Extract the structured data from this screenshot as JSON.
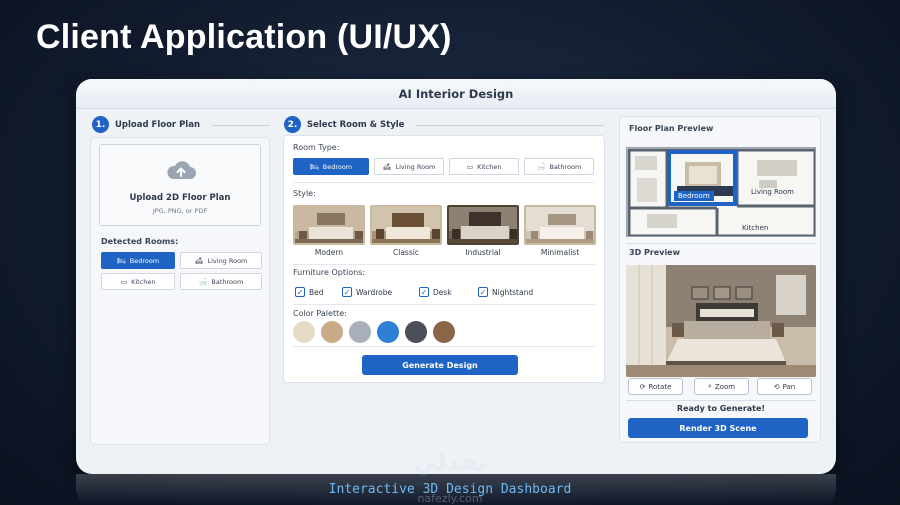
{
  "slide": {
    "title": "Client Application (UI/UX)",
    "caption": "Interactive 3D Design Dashboard",
    "watermark_text": "nafezly.com"
  },
  "window": {
    "title": "AI Interior Design"
  },
  "upload": {
    "step": "1.",
    "heading": "Upload Floor Plan",
    "box_title": "Upload 2D Floor Plan",
    "box_sub": "JPG, PNG, or PDF",
    "detected_label": "Detected Rooms:",
    "rooms": [
      "Bedroom",
      "Living Room",
      "Kitchen",
      "Bathroom"
    ],
    "active_room": "Bedroom"
  },
  "select": {
    "step": "2.",
    "heading": "Select Room & Style",
    "room_type_label": "Room Type:",
    "room_types": [
      "Bedroom",
      "Living Room",
      "Kitchen",
      "Bathroom"
    ],
    "style_label": "Style:",
    "styles": [
      "Modern",
      "Classic",
      "Industrial",
      "Minimalist"
    ],
    "selected_style": "Industrial",
    "furniture_label": "Furniture Options:",
    "furniture": [
      {
        "label": "Bed",
        "checked": true
      },
      {
        "label": "Wardrobe",
        "checked": true
      },
      {
        "label": "Desk",
        "checked": true
      },
      {
        "label": "Nightstand",
        "checked": true
      }
    ],
    "palette_label": "Color Palette:",
    "palette": [
      "#e8dcc6",
      "#c9ab88",
      "#a9b0b9",
      "#2f7fd6",
      "#4a4f58",
      "#8a6647"
    ],
    "generate_label": "Generate Design"
  },
  "preview": {
    "floor_plan_title": "Floor Plan Preview",
    "fp_labels": {
      "bedroom": "Bedroom",
      "living": "Living Room",
      "kitchen": "Kitchen"
    },
    "preview3d_title": "3D Preview",
    "controls": [
      "Rotate",
      "Zoom",
      "Pan"
    ],
    "status": "Ready to Generate!",
    "render_label": "Render 3D Scene"
  },
  "colors": {
    "accent": "#1f63c4",
    "background": "#121c2e",
    "caption": "#6fb8f0"
  },
  "icons": [
    "cloud-upload-icon",
    "bed-icon",
    "sofa-icon",
    "stove-icon",
    "bathtub-icon",
    "checkbox-icon",
    "rotate-icon",
    "zoom-icon",
    "pan-icon"
  ]
}
